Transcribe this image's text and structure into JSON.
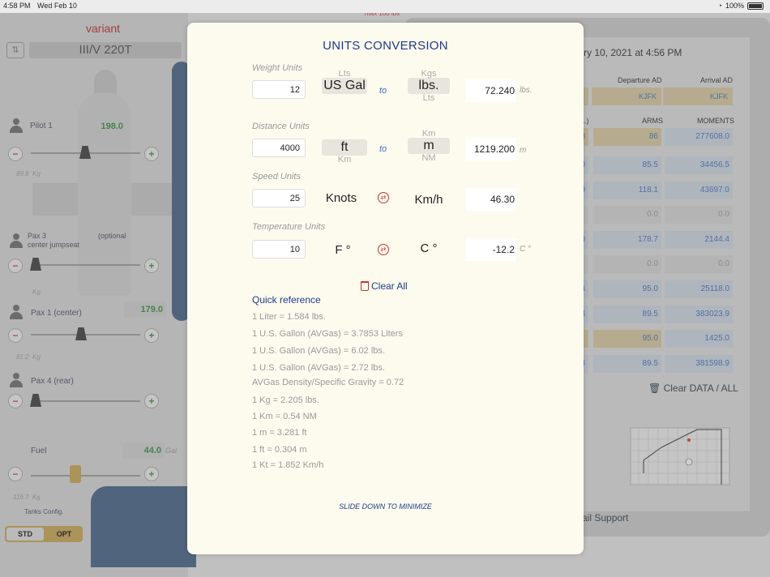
{
  "status": {
    "time": "4:58 PM",
    "date": "Wed Feb 10",
    "battery": "100%"
  },
  "background": {
    "variant": "variant",
    "model": "III/V 220T",
    "max_weight": "max 100 lbs",
    "seats": [
      {
        "label": "Pilot 1",
        "value": "198.0",
        "kg": "89.8",
        "kg_unit": "Kg"
      },
      {
        "label": "Pax 3\ncenter jumpseat",
        "note": "(optional",
        "kg_unit": "Kg"
      },
      {
        "label": "Pax 1 (center)",
        "value": "179.0",
        "kg": "81.2",
        "kg_unit": "Kg"
      },
      {
        "label": "Pax 4 (rear)"
      }
    ],
    "fuel": {
      "label": "Fuel",
      "value": "44.0",
      "unit": "Gal.",
      "kg": "119.7",
      "kg_unit": "Kg"
    },
    "tanks_label": "Tanks Config.",
    "tank_options": [
      "STD",
      "OPT"
    ],
    "date_text": "ry 10, 2021 at 4:56 PM",
    "headers": {
      "s": "S",
      "departure": "Departure AD",
      "arrival": "Arrival AD",
      "l": "L.)",
      "arms": "ARMS",
      "moments": "MOMENTS"
    },
    "airports": {
      "departure": "KJFK",
      "arrival": "KJFK"
    },
    "rows": [
      {
        "left": "8",
        "arm": "86",
        "moment": "277608.0",
        "hl": true
      },
      {
        "left": ".0",
        "arm": "85.5",
        "moment": "34456.5"
      },
      {
        "left": ".0",
        "arm": "118.1",
        "moment": "43697.0"
      },
      {
        "left": "",
        "arm": "0.0",
        "moment": "0.0",
        "gray": true
      },
      {
        "left": ".0",
        "arm": "178.7",
        "moment": "2144.4"
      },
      {
        "left": "",
        "arm": "0.0",
        "moment": "0.0",
        "gray": true
      },
      {
        "left": ".4",
        "arm": "95.0",
        "moment": "25118.0"
      },
      {
        "left": ".4",
        "arm": "89.5",
        "moment": "383023.9"
      },
      {
        "left": "",
        "arm": "95.0",
        "moment": "1425.0",
        "hl2": true
      },
      {
        "left": ".4",
        "arm": "89.5",
        "moment": "381598.9"
      }
    ],
    "clear_data": "Clear DATA / ALL",
    "mail_support": "ail Support"
  },
  "modal": {
    "title": "UNITS CONVERSION",
    "weight": {
      "label": "Weight Units",
      "input": "12",
      "from_above": "Lts",
      "from": "US Gal",
      "to_word": "to",
      "to_above": "Kgs",
      "to": "lbs.",
      "to_below": "Lts",
      "result": "72.240",
      "result_unit": "lbs."
    },
    "distance": {
      "label": "Distance Units",
      "input": "4000",
      "from": "ft",
      "from_below": "Km",
      "to_word": "to",
      "to_above": "Km",
      "to": "m",
      "to_below": "NM",
      "result": "1219.200",
      "result_unit": "m"
    },
    "speed": {
      "label": "Speed Units",
      "input": "25",
      "from": "Knots",
      "to": "Km/h",
      "result": "46.30",
      "result_unit": ""
    },
    "temperature": {
      "label": "Temperature Units",
      "input": "10",
      "from": "F °",
      "to": "C °",
      "result": "-12.2",
      "result_unit": "C °"
    },
    "clear_all": "Clear All",
    "quick_ref_title": "Quick reference",
    "quick_ref": [
      "1  Liter = 1.584 lbs.",
      "1  U.S. Gallon (AVGas) = 3.7853 Liters",
      "1  U.S. Gallon (AVGas) = 6.02 lbs.",
      "1  U.S. Gallon (AVGas) = 2.72 lbs.",
      "AVGas Density/Specific Gravity = 0.72",
      "1  Kg = 2.205 lbs.",
      "1  Km = 0.54 NM",
      "1  m = 3.281 ft",
      "1  ft = 0.304 m",
      "1  Kt = 1.852 Km/h"
    ],
    "slide_down": "SLIDE DOWN TO MINIMIZE"
  }
}
